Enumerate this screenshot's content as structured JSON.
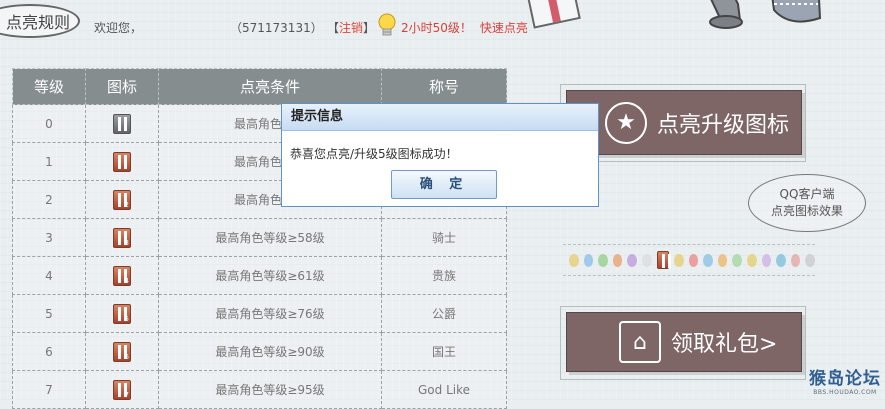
{
  "header": {
    "rules_label": "点亮规则",
    "welcome": "欢迎您，",
    "qq_number": "（571173131）",
    "logout_left": "【",
    "logout_link": "注销",
    "logout_right": "】",
    "promo_text": "2小时50级！",
    "promo_link": "快速点亮"
  },
  "table": {
    "headers": [
      "等级",
      "图标",
      "点亮条件",
      "称号"
    ],
    "rows": [
      {
        "level": "0",
        "icon_num": "",
        "condition": "最高角色等级",
        "title": ""
      },
      {
        "level": "1",
        "icon_num": "",
        "condition": "最高角色等级",
        "title": ""
      },
      {
        "level": "2",
        "icon_num": "2",
        "condition": "最高角色等级",
        "title": ""
      },
      {
        "level": "3",
        "icon_num": "3",
        "condition": "最高角色等级≥58级",
        "title": "骑士"
      },
      {
        "level": "4",
        "icon_num": "4",
        "condition": "最高角色等级≥61级",
        "title": "贵族"
      },
      {
        "level": "5",
        "icon_num": "5",
        "condition": "最高角色等级≥76级",
        "title": "公爵"
      },
      {
        "level": "6",
        "icon_num": "6",
        "condition": "最高角色等级≥90级",
        "title": "国王"
      },
      {
        "level": "7",
        "icon_num": "7",
        "condition": "最高角色等级≥95级",
        "title": "God Like"
      }
    ]
  },
  "right": {
    "upgrade_button": "点亮升级图标",
    "cloud_line1": "QQ客户端",
    "cloud_line2": "点亮图标效果",
    "gift_button": "领取礼包>"
  },
  "dialog": {
    "title": "提示信息",
    "message": "恭喜您点亮/升级5级图标成功！",
    "ok": "确 定"
  },
  "watermark": {
    "brand": "猴岛论坛",
    "url": "BBS.HOUDAO.COM"
  },
  "colors": {
    "table_header": "#858d8f",
    "panel_brown": "#7e6566",
    "accent_red": "#d9403a",
    "dialog_border": "#5d93c9"
  },
  "icons": [
    "star-icon",
    "gift-box-icon",
    "bulb-icon",
    "level-badge-icon"
  ]
}
